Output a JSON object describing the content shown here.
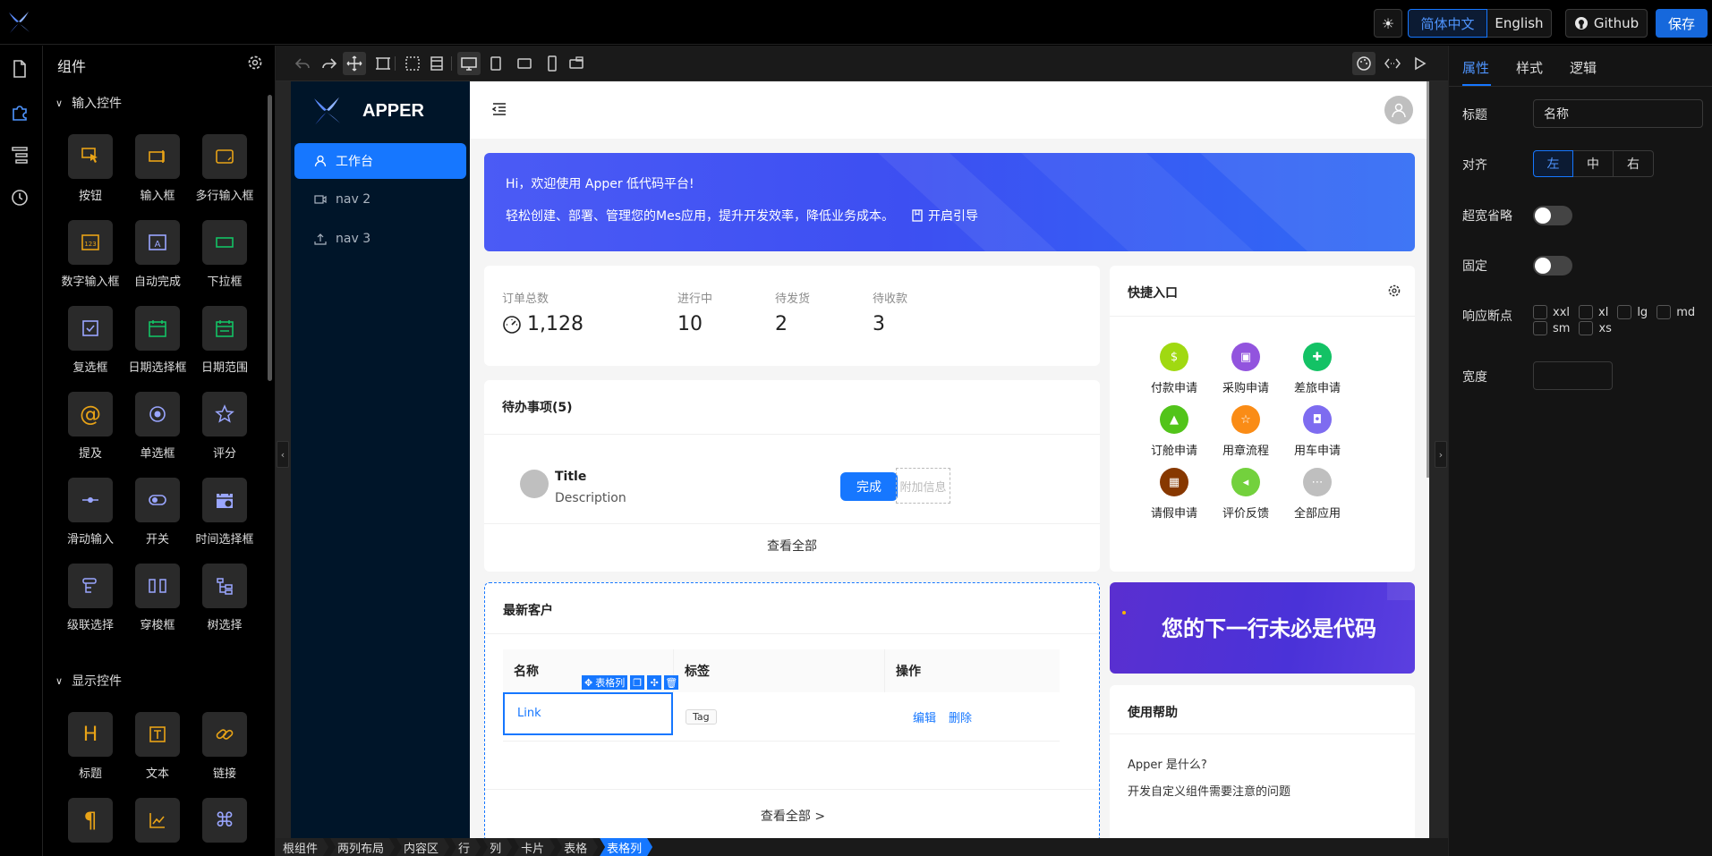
{
  "topbar": {
    "lang_zh": "简体中文",
    "lang_en": "English",
    "github": "Github",
    "save": "保存"
  },
  "panel": {
    "title": "组件",
    "sections": [
      {
        "title": "输入控件",
        "items": [
          {
            "label": "按钮",
            "icon": "pointer-icon"
          },
          {
            "label": "输入框",
            "icon": "input-icon"
          },
          {
            "label": "多行输入框",
            "icon": "textarea-icon"
          },
          {
            "label": "数字输入框",
            "icon": "number-icon"
          },
          {
            "label": "自动完成",
            "icon": "autocomplete-icon"
          },
          {
            "label": "下拉框",
            "icon": "select-icon"
          },
          {
            "label": "复选框",
            "icon": "checkbox-icon"
          },
          {
            "label": "日期选择框",
            "icon": "calendar-icon"
          },
          {
            "label": "日期范围",
            "icon": "calendar-range-icon"
          },
          {
            "label": "提及",
            "icon": "at-icon"
          },
          {
            "label": "单选框",
            "icon": "radio-icon"
          },
          {
            "label": "评分",
            "icon": "star-icon"
          },
          {
            "label": "滑动输入",
            "icon": "slider-icon"
          },
          {
            "label": "开关",
            "icon": "switch-icon"
          },
          {
            "label": "时间选择框",
            "icon": "time-picker-icon"
          },
          {
            "label": "级联选择",
            "icon": "cascader-icon"
          },
          {
            "label": "穿梭框",
            "icon": "transfer-icon"
          },
          {
            "label": "树选择",
            "icon": "tree-select-icon"
          }
        ]
      },
      {
        "title": "显示控件",
        "items": [
          {
            "label": "标题",
            "icon": "heading-icon"
          },
          {
            "label": "文本",
            "icon": "text-icon"
          },
          {
            "label": "链接",
            "icon": "link-icon"
          }
        ]
      }
    ]
  },
  "app": {
    "brand": "APPER",
    "nav": [
      "工作台",
      "nav 2",
      "nav 3"
    ],
    "banner": {
      "hi": "Hi，欢迎使用 Apper 低代码平台!",
      "sub": "轻松创建、部署、管理您的Mes应用，提升开发效率，降低业务成本。",
      "guide": "开启引导"
    },
    "stats": [
      {
        "title": "订单总数",
        "value": "1,128"
      },
      {
        "title": "进行中",
        "value": "10"
      },
      {
        "title": "待发货",
        "value": "2"
      },
      {
        "title": "待收款",
        "value": "3"
      }
    ],
    "todo": {
      "title": "待办事项(5)",
      "item_title": "Title",
      "item_desc": "Description",
      "done": "完成",
      "extra": "附加信息",
      "view_all": "查看全部"
    },
    "quick": {
      "title": "快捷入口",
      "items": [
        {
          "label": "付款申请",
          "color": "#a0d911",
          "icon": "dollar-icon"
        },
        {
          "label": "采购申请",
          "color": "#9254de",
          "icon": "bag-icon"
        },
        {
          "label": "差旅申请",
          "color": "#13c265",
          "icon": "gift-icon"
        },
        {
          "label": "订舱申请",
          "color": "#52c41a",
          "icon": "rocket-icon"
        },
        {
          "label": "用章流程",
          "color": "#fa8c16",
          "icon": "stamp-star-icon"
        },
        {
          "label": "用车申请",
          "color": "#7e6cf0",
          "icon": "car-icon"
        },
        {
          "label": "请假申请",
          "color": "#873800",
          "icon": "calendar-leave-icon"
        },
        {
          "label": "评价反馈",
          "color": "#73d13d",
          "icon": "feedback-icon"
        },
        {
          "label": "全部应用",
          "color": "#bfbfbf",
          "icon": "more-icon"
        }
      ]
    },
    "customers": {
      "title": "最新客户",
      "cols": [
        "名称",
        "标签",
        "操作"
      ],
      "row": {
        "name": "Link",
        "tag": "Tag",
        "edit": "编辑",
        "del": "删除"
      },
      "sel_label": "表格列",
      "view_all": "查看全部 >"
    },
    "ad": "您的下一行未必是代码",
    "help": {
      "title": "使用帮助",
      "q1": "Apper 是什么?",
      "q2": "开发自定义组件需要注意的问题"
    }
  },
  "breadcrumb": [
    "根组件",
    "两列布局",
    "内容区",
    "行",
    "列",
    "卡片",
    "表格",
    "表格列"
  ],
  "props": {
    "tabs": [
      "属性",
      "样式",
      "逻辑"
    ],
    "title_label": "标题",
    "title_value": "名称",
    "align_label": "对齐",
    "align_options": [
      "左",
      "中",
      "右"
    ],
    "ellipsis_label": "超宽省略",
    "fixed_label": "固定",
    "breakpoints_label": "响应断点",
    "breakpoints": [
      "xxl",
      "xl",
      "lg",
      "md",
      "sm",
      "xs"
    ],
    "width_label": "宽度"
  },
  "colors": {
    "accent": "#1677ff",
    "sider": "#001529"
  }
}
